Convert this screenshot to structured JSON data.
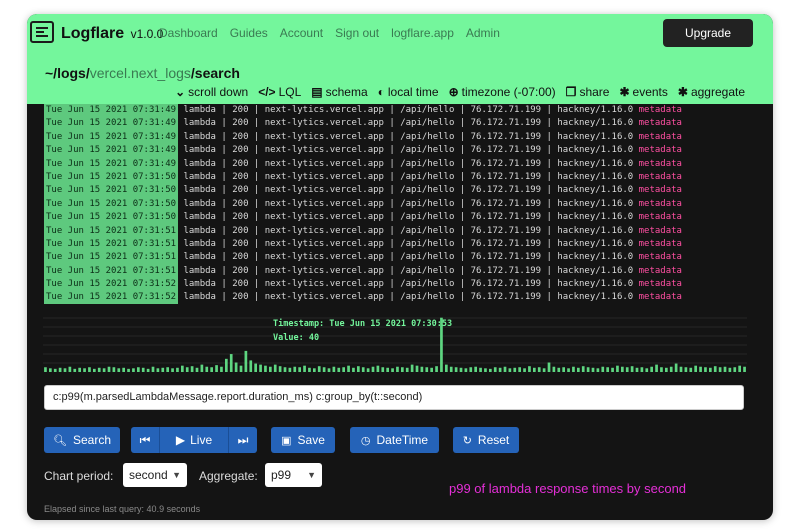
{
  "navbar": {
    "brand": "Logflare",
    "version": "v1.0.0",
    "links": [
      "Dashboard",
      "Guides",
      "Account",
      "Sign out",
      "logflare.app",
      "Admin"
    ],
    "upgrade_label": "Upgrade"
  },
  "path": {
    "prefix": "~/logs/",
    "source": "vercel.next_logs",
    "suffix": "/search"
  },
  "actions": [
    {
      "icon": "chevron-down-circle-icon",
      "glyph": "⌄",
      "label": "scroll down"
    },
    {
      "icon": "code-icon",
      "glyph": "</>",
      "label": "LQL"
    },
    {
      "icon": "database-icon",
      "glyph": "▤",
      "label": "schema"
    },
    {
      "icon": "toggle-icon",
      "glyph": "◐",
      "label": "local time"
    },
    {
      "icon": "globe-icon",
      "glyph": "⊕",
      "label": "timezone (-07:00)"
    },
    {
      "icon": "copy-icon",
      "glyph": "❐",
      "label": "share"
    },
    {
      "icon": "bug-icon",
      "glyph": "✱",
      "label": "events"
    },
    {
      "icon": "bug-icon",
      "glyph": "✱",
      "label": "aggregate"
    }
  ],
  "log_rows": [
    {
      "ts": "Tue Jun 15 2021 07:31:49",
      "rest": " lambda | 200 | next-lytics.vercel.app | /api/hello | 76.172.71.199 | hackney/1.16.0 ",
      "meta": "metadata"
    },
    {
      "ts": "Tue Jun 15 2021 07:31:49",
      "rest": " lambda | 200 | next-lytics.vercel.app | /api/hello | 76.172.71.199 | hackney/1.16.0 ",
      "meta": "metadata"
    },
    {
      "ts": "Tue Jun 15 2021 07:31:49",
      "rest": " lambda | 200 | next-lytics.vercel.app | /api/hello | 76.172.71.199 | hackney/1.16.0 ",
      "meta": "metadata"
    },
    {
      "ts": "Tue Jun 15 2021 07:31:49",
      "rest": " lambda | 200 | next-lytics.vercel.app | /api/hello | 76.172.71.199 | hackney/1.16.0 ",
      "meta": "metadata"
    },
    {
      "ts": "Tue Jun 15 2021 07:31:49",
      "rest": " lambda | 200 | next-lytics.vercel.app | /api/hello | 76.172.71.199 | hackney/1.16.0 ",
      "meta": "metadata"
    },
    {
      "ts": "Tue Jun 15 2021 07:31:50",
      "rest": " lambda | 200 | next-lytics.vercel.app | /api/hello | 76.172.71.199 | hackney/1.16.0 ",
      "meta": "metadata"
    },
    {
      "ts": "Tue Jun 15 2021 07:31:50",
      "rest": " lambda | 200 | next-lytics.vercel.app | /api/hello | 76.172.71.199 | hackney/1.16.0 ",
      "meta": "metadata"
    },
    {
      "ts": "Tue Jun 15 2021 07:31:50",
      "rest": " lambda | 200 | next-lytics.vercel.app | /api/hello | 76.172.71.199 | hackney/1.16.0 ",
      "meta": "metadata"
    },
    {
      "ts": "Tue Jun 15 2021 07:31:50",
      "rest": " lambda | 200 | next-lytics.vercel.app | /api/hello | 76.172.71.199 | hackney/1.16.0 ",
      "meta": "metadata"
    },
    {
      "ts": "Tue Jun 15 2021 07:31:51",
      "rest": " lambda | 200 | next-lytics.vercel.app | /api/hello | 76.172.71.199 | hackney/1.16.0 ",
      "meta": "metadata"
    },
    {
      "ts": "Tue Jun 15 2021 07:31:51",
      "rest": " lambda | 200 | next-lytics.vercel.app | /api/hello | 76.172.71.199 | hackney/1.16.0 ",
      "meta": "metadata"
    },
    {
      "ts": "Tue Jun 15 2021 07:31:51",
      "rest": " lambda | 200 | next-lytics.vercel.app | /api/hello | 76.172.71.199 | hackney/1.16.0 ",
      "meta": "metadata"
    },
    {
      "ts": "Tue Jun 15 2021 07:31:51",
      "rest": " lambda | 200 | next-lytics.vercel.app | /api/hello | 76.172.71.199 | hackney/1.16.0 ",
      "meta": "metadata"
    },
    {
      "ts": "Tue Jun 15 2021 07:31:52",
      "rest": " lambda | 200 | next-lytics.vercel.app | /api/hello | 76.172.71.199 | hackney/1.16.0 ",
      "meta": "metadata"
    },
    {
      "ts": "Tue Jun 15 2021 07:31:52",
      "rest": " lambda | 200 | next-lytics.vercel.app | /api/hello | 76.172.71.199 | hackney/1.16.0 ",
      "meta": "metadata"
    }
  ],
  "chart_data": {
    "type": "bar",
    "color": "#5ed681",
    "ylim": [
      0,
      110
    ],
    "values": [
      9,
      7,
      6,
      8,
      7,
      10,
      6,
      8,
      7,
      9,
      6,
      8,
      7,
      10,
      9,
      7,
      8,
      6,
      7,
      9,
      8,
      6,
      10,
      7,
      8,
      9,
      7,
      8,
      12,
      9,
      11,
      8,
      14,
      10,
      9,
      13,
      10,
      25,
      34,
      18,
      12,
      40,
      22,
      16,
      14,
      12,
      10,
      14,
      11,
      9,
      8,
      10,
      9,
      12,
      8,
      7,
      11,
      9,
      7,
      10,
      8,
      9,
      12,
      8,
      11,
      9,
      7,
      10,
      12,
      9,
      8,
      7,
      10,
      9,
      8,
      14,
      12,
      10,
      9,
      8,
      11,
      103,
      14,
      10,
      9,
      8,
      7,
      9,
      10,
      8,
      7,
      6,
      9,
      8,
      10,
      7,
      8,
      9,
      7,
      11,
      8,
      9,
      7,
      18,
      10,
      8,
      9,
      7,
      10,
      8,
      11,
      9,
      8,
      7,
      10,
      9,
      8,
      12,
      10,
      9,
      11,
      8,
      9,
      7,
      10,
      14,
      9,
      8,
      10,
      16,
      10,
      9,
      8,
      12,
      10,
      9,
      8,
      11,
      9,
      10,
      8,
      9,
      12,
      10
    ],
    "tooltip_timestamp": "Timestamp: Tue Jun 15 2021 07:30:53",
    "tooltip_value": "Value: 40"
  },
  "query": {
    "value": "c:p99(m.parsedLambdaMessage.report.duration_ms) c:group_by(t::second)"
  },
  "buttons": {
    "search": "Search",
    "live": "Live",
    "save": "Save",
    "datetime": "DateTime",
    "reset": "Reset"
  },
  "controls": {
    "chart_period_label": "Chart period:",
    "chart_period_value": "second",
    "aggregate_label": "Aggregate:",
    "aggregate_value": "p99"
  },
  "caption": "p99 of lambda response times by second",
  "elapsed": "Elapsed since last query: 40.9 seconds"
}
